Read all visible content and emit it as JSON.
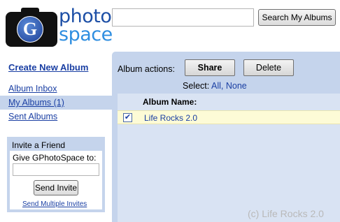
{
  "logo": {
    "letter": "G",
    "line1": "photo",
    "line2": "space"
  },
  "search": {
    "value": "",
    "button_label": "Search My Albums"
  },
  "nav": {
    "create_label": "Create New Album",
    "items": [
      {
        "label": "Album Inbox"
      },
      {
        "label": "My Albums (1)"
      },
      {
        "label": "Sent Albums"
      }
    ]
  },
  "invite": {
    "title": "Invite a Friend",
    "field_label": "Give GPhotoSpace to:",
    "value": "",
    "button_label": "Send Invite",
    "link_label": "Send Multiple Invites"
  },
  "main": {
    "actions_label": "Album actions:",
    "share_label": "Share",
    "delete_label": "Delete",
    "select_label": "Select:",
    "select_all": "All,",
    "select_none": "None",
    "column_header": "Album Name:",
    "albums": [
      {
        "name": "Life Rocks 2.0",
        "checked": true
      }
    ]
  },
  "watermark": "(c) Life Rocks 2.0",
  "colors": {
    "panel": "#c5d4ec",
    "list": "#d9e3f3",
    "row": "#fdfbd6",
    "link": "#1a3fa3"
  }
}
